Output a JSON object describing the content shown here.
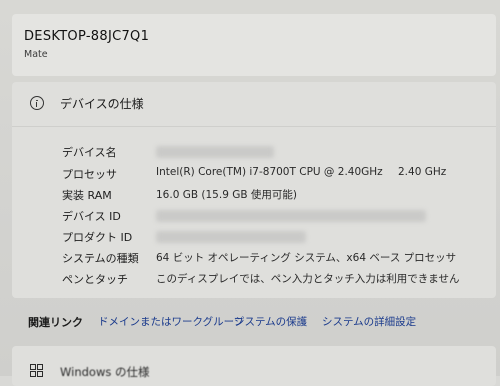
{
  "device": {
    "name": "DESKTOP-88JC7Q1",
    "model": "Mate"
  },
  "specs": {
    "title": "デバイスの仕様",
    "rows": [
      {
        "label": "デバイス名",
        "value": ""
      },
      {
        "label": "プロセッサ",
        "value": "Intel(R) Core(TM) i7-8700T CPU @ 2.40GHz",
        "extra": "2.40 GHz"
      },
      {
        "label": "実装 RAM",
        "value": "16.0 GB (15.9 GB 使用可能)"
      },
      {
        "label": "デバイス ID",
        "value": ""
      },
      {
        "label": "プロダクト ID",
        "value": ""
      },
      {
        "label": "システムの種類",
        "value": "64 ビット オペレーティング システム、x64 ベース プロセッサ"
      },
      {
        "label": "ペンとタッチ",
        "value": "このディスプレイでは、ペン入力とタッチ入力は利用できません"
      }
    ]
  },
  "related": {
    "label": "関連リンク",
    "links": [
      "ドメインまたはワークグループ",
      "システムの保護",
      "システムの詳細設定"
    ]
  },
  "windows_spec": {
    "title": "Windows の仕様"
  }
}
